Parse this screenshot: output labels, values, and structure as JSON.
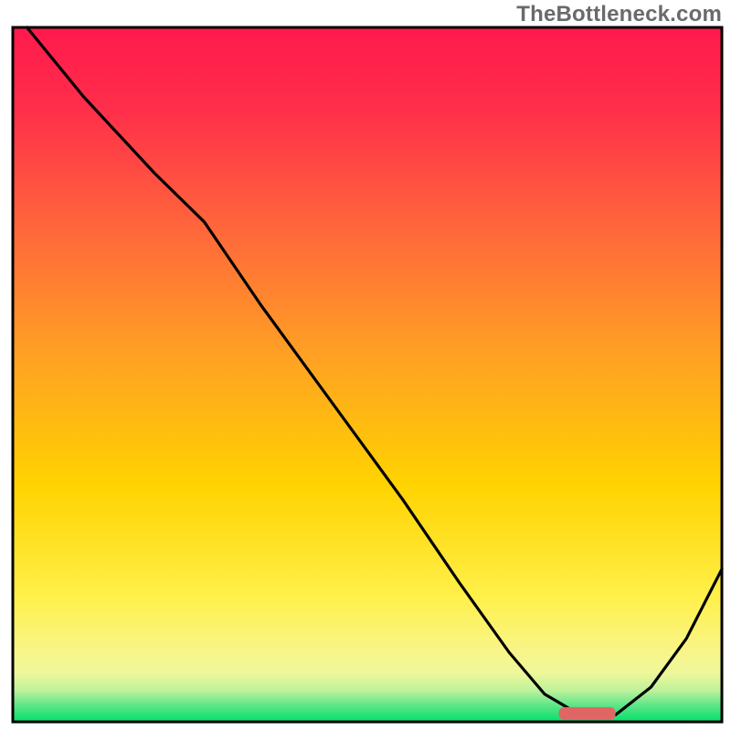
{
  "watermark": {
    "label": "TheBottleneck.com"
  },
  "chart_data": {
    "type": "line",
    "title": "",
    "xlabel": "",
    "ylabel": "",
    "xlim": [
      0,
      100
    ],
    "ylim": [
      0,
      100
    ],
    "grid": false,
    "legend": false,
    "background_gradient": {
      "top_color": "#ff1a4d",
      "mid_color": "#ffd300",
      "low_band_color": "#f8f58a",
      "bottom_color": "#00e06a"
    },
    "series": [
      {
        "name": "bottleneck-curve",
        "x": [
          2,
          10,
          20,
          27,
          35,
          45,
          55,
          63,
          70,
          75,
          80,
          85,
          90,
          95,
          100
        ],
        "y": [
          100,
          90,
          79,
          72,
          60,
          46,
          32,
          20,
          10,
          4,
          1,
          1,
          5,
          12,
          22
        ]
      }
    ],
    "trough_marker": {
      "x_start": 77,
      "x_end": 85,
      "y": 1.2,
      "color": "#e06666"
    }
  }
}
